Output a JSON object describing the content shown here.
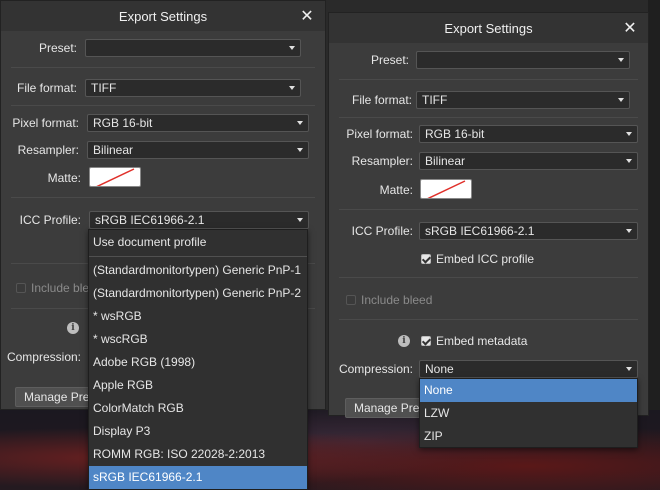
{
  "left_dialog": {
    "title": "Export Settings",
    "close_glyph": "✕",
    "labels": {
      "preset": "Preset:",
      "file_format": "File format:",
      "pixel_format": "Pixel format:",
      "resampler": "Resampler:",
      "matte": "Matte:",
      "icc_profile": "ICC Profile:",
      "compression": "Compression:"
    },
    "values": {
      "preset": "",
      "file_format": "TIFF",
      "pixel_format": "RGB 16-bit",
      "resampler": "Bilinear",
      "icc_profile": "sRGB IEC61966-2.1"
    },
    "include_bleed": "Include bleed",
    "include_bleed_checked": false,
    "manage_button": "Manage Pres",
    "info_glyph": "i",
    "icc_dropdown": {
      "items": [
        "Use document profile",
        "(Standardmonitortypen) Generic PnP-1",
        "(Standardmonitortypen) Generic PnP-2",
        "* wsRGB",
        "* wscRGB",
        "Adobe RGB (1998)",
        "Apple RGB",
        "ColorMatch RGB",
        "Display P3",
        "ROMM RGB: ISO 22028-2:2013",
        "sRGB IEC61966-2.1"
      ],
      "selected": "sRGB IEC61966-2.1"
    }
  },
  "right_dialog": {
    "title": "Export Settings",
    "close_glyph": "✕",
    "labels": {
      "preset": "Preset:",
      "file_format": "File format:",
      "pixel_format": "Pixel format:",
      "resampler": "Resampler:",
      "matte": "Matte:",
      "icc_profile": "ICC Profile:",
      "compression": "Compression:"
    },
    "values": {
      "preset": "",
      "file_format": "TIFF",
      "pixel_format": "RGB 16-bit",
      "resampler": "Bilinear",
      "icc_profile": "sRGB IEC61966-2.1",
      "compression": "None"
    },
    "embed_icc_profile": "Embed ICC profile",
    "embed_icc_checked": true,
    "include_bleed": "Include bleed",
    "include_bleed_checked": false,
    "embed_metadata": "Embed metadata",
    "embed_metadata_checked": true,
    "manage_button": "Manage Pres",
    "info_glyph": "i",
    "compression_dropdown": {
      "items": [
        "None",
        "LZW",
        "ZIP"
      ],
      "selected": "None"
    }
  },
  "colors": {
    "dialog_bg": "#3c3c3c",
    "titlebar_bg": "#333333",
    "field_bg": "#2b2b2b",
    "selection_blue": "#4f86c6",
    "matte_slash": "#e0302a"
  },
  "icons": {
    "close": "close-icon",
    "caret": "chevron-down-icon",
    "info": "info-icon",
    "check": "checkmark-icon"
  }
}
